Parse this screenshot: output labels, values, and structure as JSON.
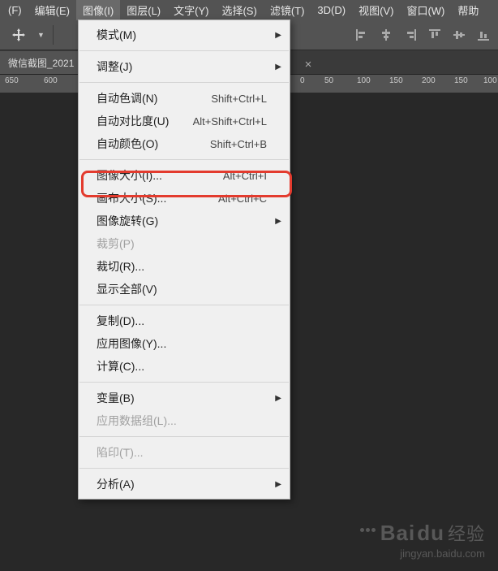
{
  "menubar": {
    "items": [
      {
        "label": "(F)"
      },
      {
        "label": "编辑(E)"
      },
      {
        "label": "图像(I)",
        "active": true
      },
      {
        "label": "图层(L)"
      },
      {
        "label": "文字(Y)"
      },
      {
        "label": "选择(S)"
      },
      {
        "label": "滤镜(T)"
      },
      {
        "label": "3D(D)"
      },
      {
        "label": "视图(V)"
      },
      {
        "label": "窗口(W)"
      },
      {
        "label": "帮助"
      }
    ]
  },
  "document": {
    "tab_title": "微信截图_2021"
  },
  "ruler": {
    "ticks": [
      "650",
      "600",
      "0",
      "50",
      "100",
      "150",
      "200",
      "150",
      "100"
    ]
  },
  "dropdown": {
    "groups": [
      [
        {
          "label": "模式(M)",
          "submenu": true
        }
      ],
      [
        {
          "label": "调整(J)",
          "submenu": true
        }
      ],
      [
        {
          "label": "自动色调(N)",
          "shortcut": "Shift+Ctrl+L"
        },
        {
          "label": "自动对比度(U)",
          "shortcut": "Alt+Shift+Ctrl+L"
        },
        {
          "label": "自动颜色(O)",
          "shortcut": "Shift+Ctrl+B"
        }
      ],
      [
        {
          "label": "图像大小(I)...",
          "shortcut": "Alt+Ctrl+I",
          "highlighted": true
        },
        {
          "label": "画布大小(S)...",
          "shortcut": "Alt+Ctrl+C"
        },
        {
          "label": "图像旋转(G)",
          "submenu": true
        },
        {
          "label": "裁剪(P)",
          "disabled": true
        },
        {
          "label": "裁切(R)..."
        },
        {
          "label": "显示全部(V)"
        }
      ],
      [
        {
          "label": "复制(D)..."
        },
        {
          "label": "应用图像(Y)..."
        },
        {
          "label": "计算(C)..."
        }
      ],
      [
        {
          "label": "变量(B)",
          "submenu": true
        },
        {
          "label": "应用数据组(L)...",
          "disabled": true
        }
      ],
      [
        {
          "label": "陷印(T)...",
          "disabled": true
        }
      ],
      [
        {
          "label": "分析(A)",
          "submenu": true
        }
      ]
    ]
  },
  "watermark": {
    "brand_a": "Bai",
    "brand_b": "du",
    "brand_cn": "经验",
    "url": "jingyan.baidu.com"
  }
}
